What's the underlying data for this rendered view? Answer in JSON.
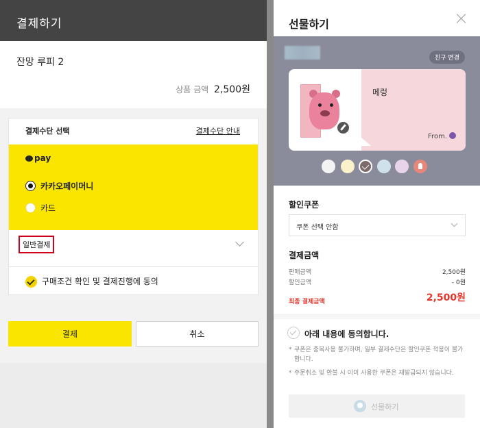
{
  "left": {
    "header_title": "결제하기",
    "product_name": "잔망 루피 2",
    "price_label": "상품 금액",
    "price_value": "2,500원",
    "payment_method_title": "결제수단 선택",
    "payment_guide_link": "결제수단 안내",
    "kakaopay_logo": "pay",
    "options": [
      "카카오페이머니",
      "카드"
    ],
    "selected_option": "카카오페이머니",
    "general_payment": "일반결제",
    "agree_text": "구매조건 확인 및 결제진행에 동의",
    "pay_button": "결제",
    "cancel_button": "취소",
    "accent_yellow": "#fae500",
    "highlight_red": "#d0021b"
  },
  "right": {
    "title": "선물하기",
    "friend_change": "친구 변경",
    "card_message": "메렁",
    "card_from": "From.",
    "color_swatches": [
      "#f3f3f3",
      "#fbf2cc",
      "#7d6b6b",
      "#cfe2ec",
      "#e7d4ea",
      "#e7877c"
    ],
    "selected_swatch": 2,
    "coupon_section": "할인쿠폰",
    "coupon_select": "쿠폰 선택 안함",
    "payment_section": "결제금액",
    "sale_label": "판매금액",
    "sale_value": "2,500원",
    "discount_label": "할인금액",
    "discount_value": "- 0원",
    "final_label": "최종 결제금액",
    "final_value": "2,500원",
    "agree_title": "아래 내용에 동의합니다.",
    "notes": [
      "쿠폰은 중복사용 불가하며, 일부 결제수단은 할인쿠폰 적용이 불가합니다.",
      "주문취소 및 환불 시 이미 사용한 쿠폰은 재발급되지 않습니다."
    ],
    "gift_button": "선물하기"
  }
}
